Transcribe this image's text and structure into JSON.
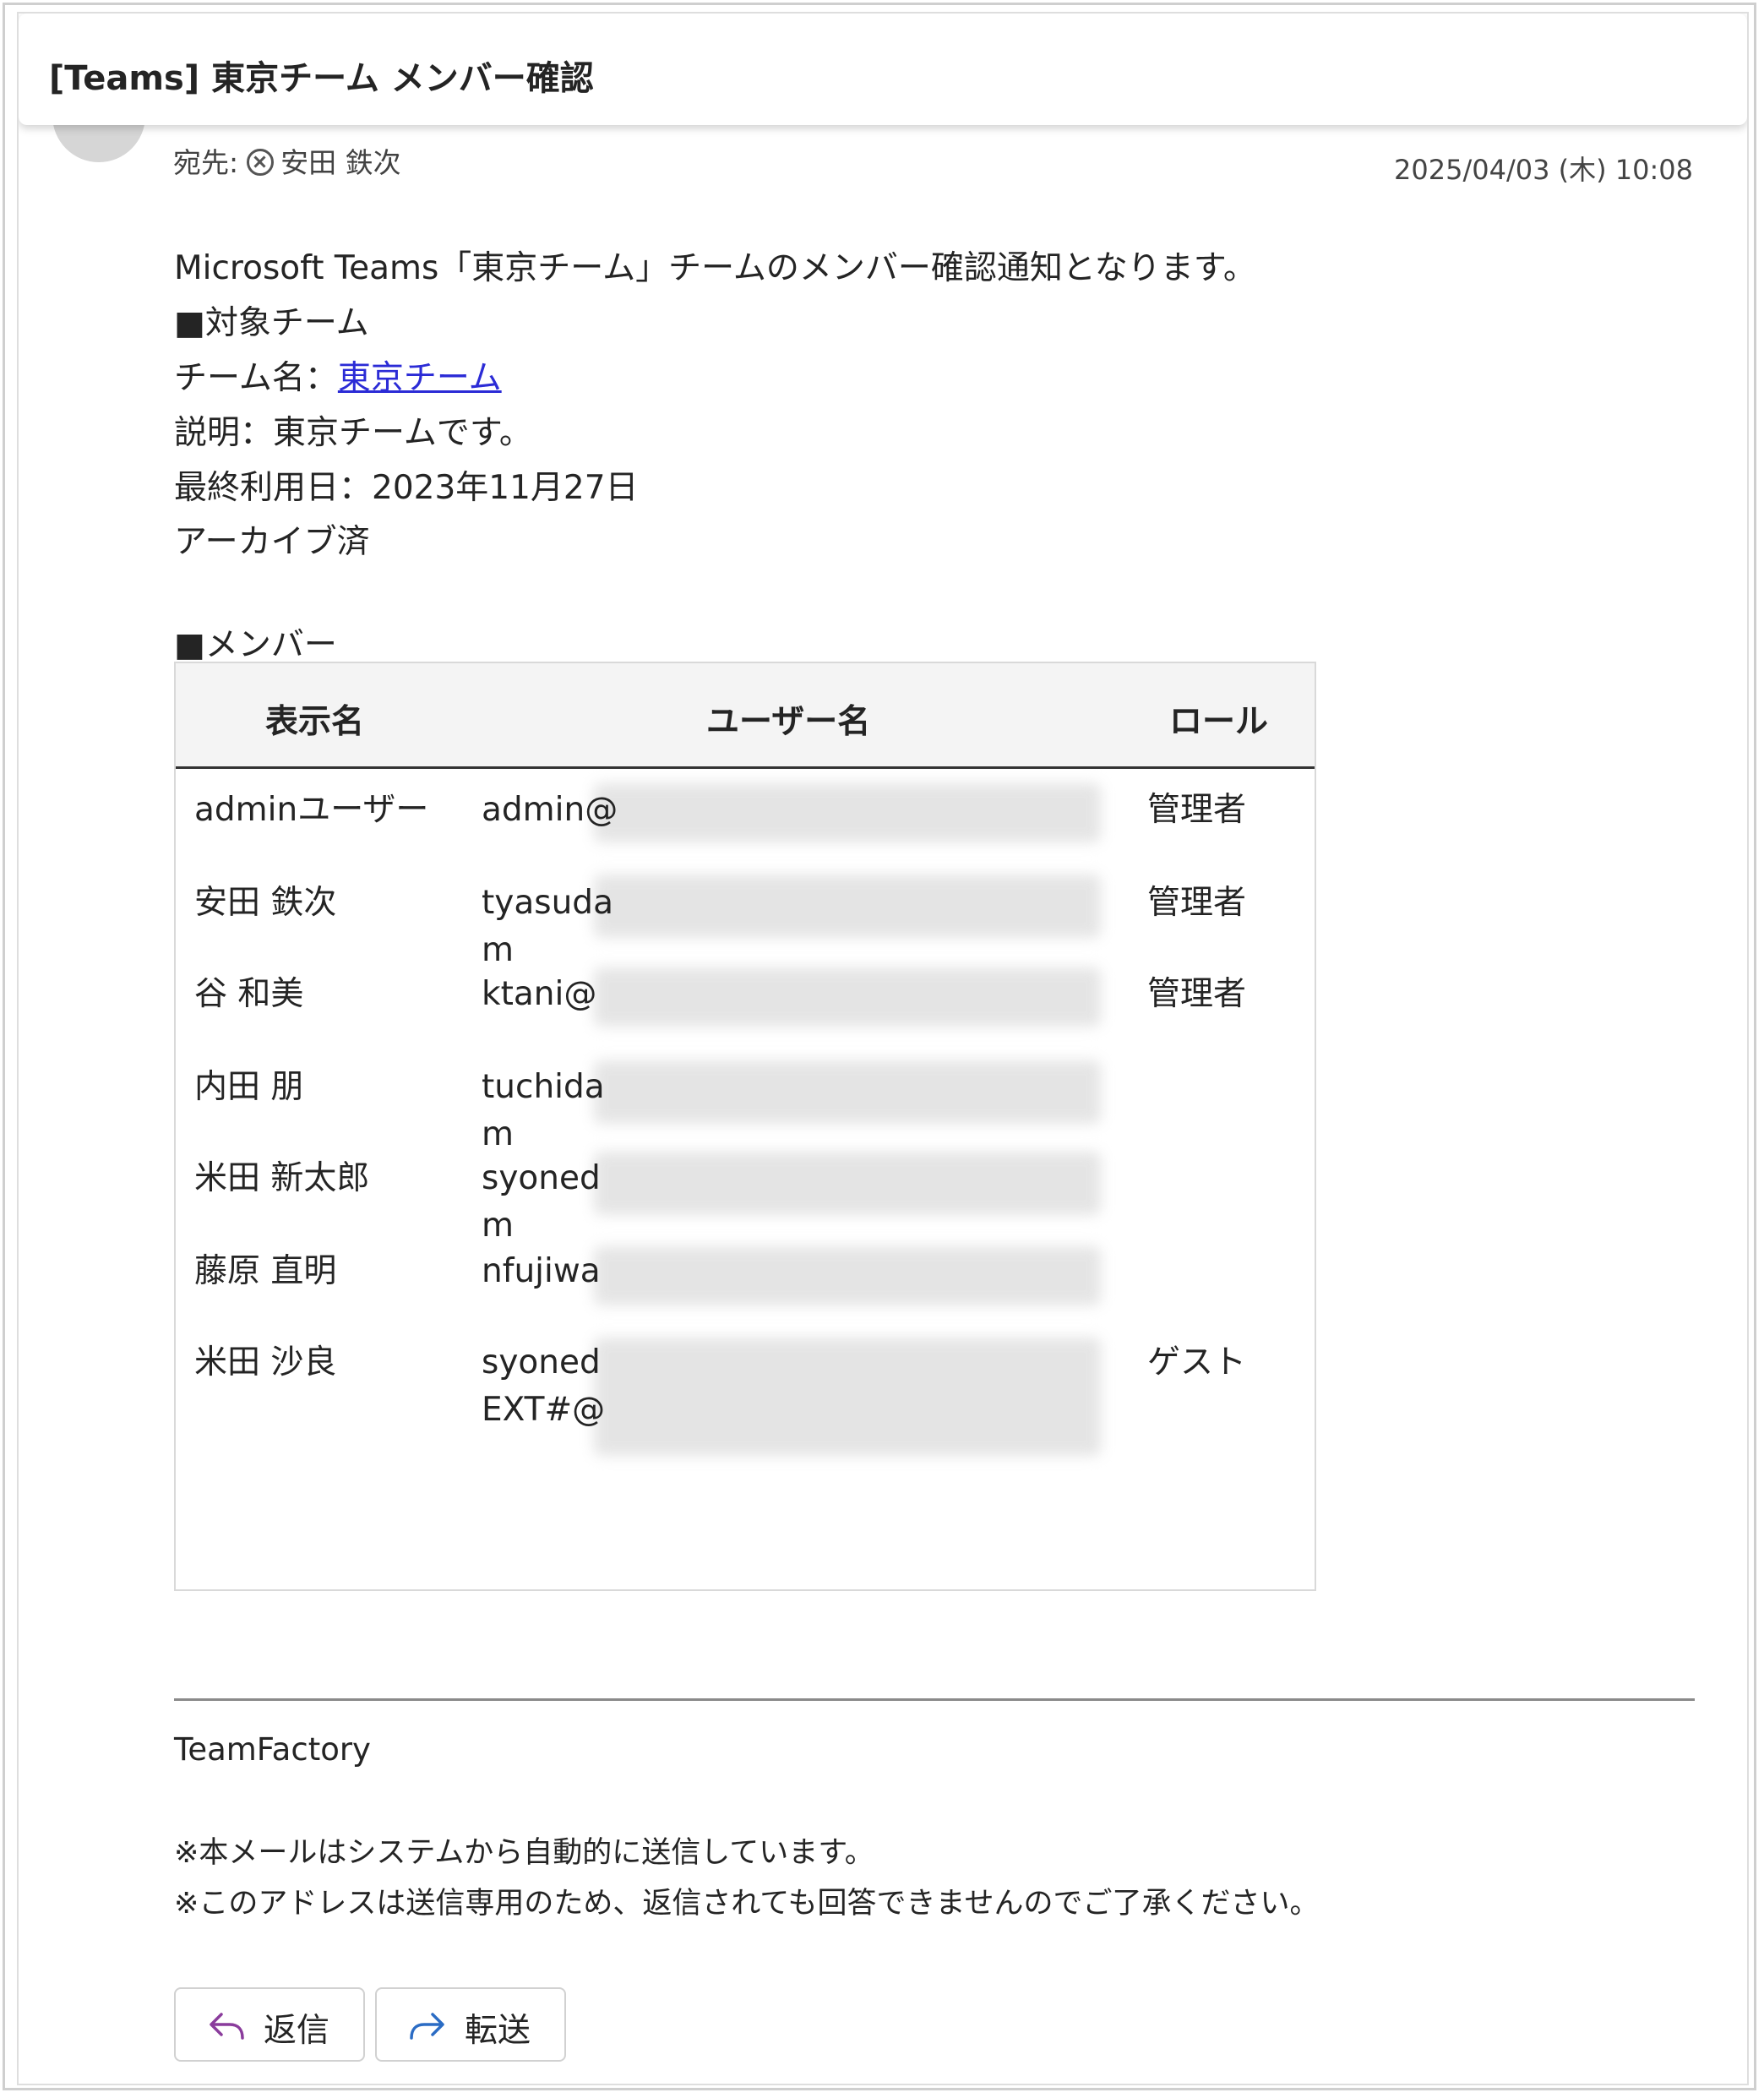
{
  "subject": "[Teams] 東京チーム メンバー確認",
  "header": {
    "to_label": "宛先:",
    "to_name": "安田 鉄次",
    "date": "2025/04/03 (木) 10:08"
  },
  "body": {
    "intro": "Microsoft Teams「東京チーム」チームのメンバー確認通知となります。",
    "target_heading": "■対象チーム",
    "team_name_label": "チーム名：",
    "team_name_link": "東京チーム",
    "description": "説明：東京チームです。",
    "last_used": "最終利用日：2023年11月27日",
    "archived": "アーカイブ済",
    "members_heading": "■メンバー"
  },
  "members_table": {
    "headers": {
      "display_name": "表示名",
      "user_name": "ユーザー名",
      "role": "ロール"
    },
    "rows": [
      {
        "display_name": "adminユーザー",
        "user_line1": "admin@",
        "user_line2": "",
        "role": "管理者"
      },
      {
        "display_name": "安田 鉄次",
        "user_line1": "tyasuda",
        "user_line2": "m",
        "role": "管理者"
      },
      {
        "display_name": "谷 和美",
        "user_line1": "ktani@",
        "user_line2": "",
        "role": "管理者"
      },
      {
        "display_name": "内田 朋",
        "user_line1": "tuchida",
        "user_line2": "m",
        "role": ""
      },
      {
        "display_name": "米田 新太郎",
        "user_line1": "syoned",
        "user_line2": "m",
        "role": ""
      },
      {
        "display_name": "藤原 直明",
        "user_line1": "nfujiwa",
        "user_line2": "",
        "role": ""
      },
      {
        "display_name": "米田 沙良",
        "user_line1": "syoned",
        "user_line2": "EXT#@",
        "role": "ゲスト"
      }
    ]
  },
  "footer": {
    "sender": "TeamFactory",
    "note1": "※本メールはシステムから自動的に送信しています。",
    "note2": "※このアドレスは送信専用のため、返信されても回答できませんのでご了承ください。"
  },
  "actions": {
    "reply_label": "返信",
    "forward_label": "転送",
    "reply_icon": "reply-arrow-icon",
    "forward_icon": "forward-arrow-icon",
    "reply_icon_color": "#8a3c9c",
    "forward_icon_color": "#2b6cc4"
  }
}
